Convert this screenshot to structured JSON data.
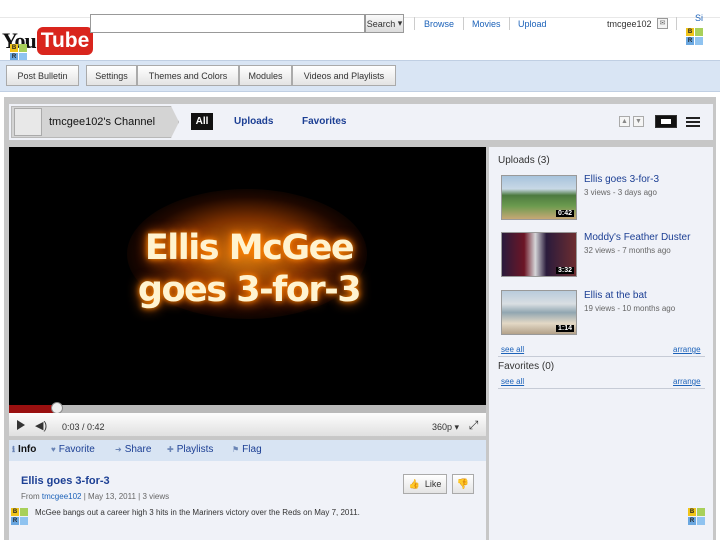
{
  "header": {
    "logo_you": "You",
    "logo_tube": "Tube",
    "search_button": "Search",
    "links": [
      "Browse",
      "Movies",
      "Upload"
    ],
    "username": "tmcgee102",
    "signout": "Si"
  },
  "blocks": [
    "B",
    "",
    "R",
    ""
  ],
  "edit_bar": {
    "post_bulletin": "Post Bulletin",
    "settings": "Settings",
    "themes": "Themes and Colors",
    "modules": "Modules",
    "videos_playlists": "Videos and Playlists"
  },
  "channel": {
    "name": "tmcgee102's Channel",
    "tabs": [
      "All",
      "Uploads",
      "Favorites"
    ]
  },
  "player": {
    "title_line1": "Ellis McGee",
    "title_line2": "goes 3-for-3",
    "time": "0:03 / 0:42",
    "quality": "360p",
    "progress_fraction": 0.098
  },
  "info_tabs": [
    "Info",
    "Favorite",
    "Share",
    "Playlists",
    "Flag"
  ],
  "video_info": {
    "title": "Ellis goes 3-for-3",
    "from_label": "From",
    "from_user": "tmcgee102",
    "date": "May 13, 2011",
    "views": "3 views",
    "description": "McGee bangs out a career high 3 hits in the Mariners victory over the Reds on May 7, 2011.",
    "like_label": "Like"
  },
  "sidebar": {
    "uploads_heading": "Uploads (3)",
    "uploads": [
      {
        "title": "Ellis goes 3-for-3",
        "meta": "3 views - 3 days ago",
        "duration": "0:42"
      },
      {
        "title": "Moddy's Feather Duster",
        "meta": "32 views - 7 months ago",
        "duration": "3:32"
      },
      {
        "title": "Ellis at the bat",
        "meta": "19 views - 10 months ago",
        "duration": "1:14"
      }
    ],
    "see_all": "see all",
    "arrange": "arrange",
    "favorites_heading": "Favorites (0)"
  },
  "colors": {
    "brand": "#d9251d",
    "link": "#1c3f94",
    "progress": "#9a1010"
  }
}
